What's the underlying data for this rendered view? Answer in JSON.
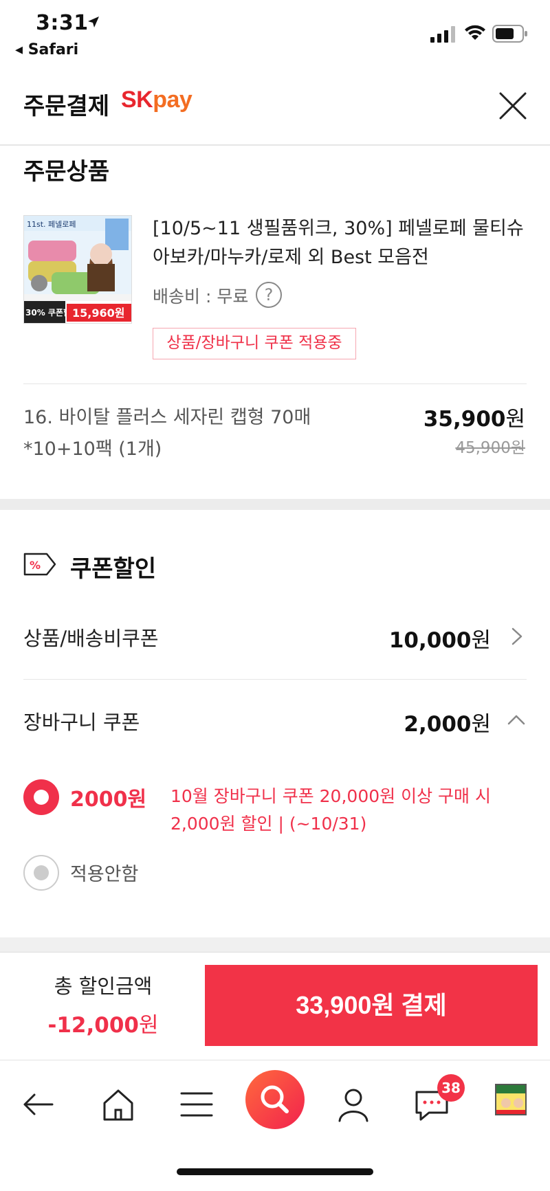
{
  "status_bar": {
    "time": "3:31",
    "back_app": "Safari"
  },
  "header": {
    "title": "주문결제",
    "brand_sk": "SK",
    "brand_pay": "pay"
  },
  "order_section": {
    "title": "주문상품",
    "product_name": "[10/5~11 생필품위크, 30%] 페넬로페 물티슈 아보카/마누카/로제 외 Best 모음전",
    "shipping": "배송비 : 무료",
    "help_symbol": "?",
    "coupon_tag": "상품/장바구니 쿠폰 적용중",
    "thumb_texts": {
      "brand": "11st. 페넬로페",
      "sale": "30% 쿠폰할인",
      "price": "15,960원"
    },
    "option_name": "16. 바이탈 플러스 세자린 캡형 70매*10+10팩 (1개)",
    "price": "35,900",
    "price_unit": "원",
    "original_price": "45,900원"
  },
  "coupon_section": {
    "title": "쿠폰할인",
    "icon_symbol": "%",
    "product_coupon_label": "상품/배송비쿠폰",
    "product_coupon_value": "10,000",
    "cart_coupon_label": "장바구니 쿠폰",
    "cart_coupon_value": "2,000",
    "unit": "원",
    "options": [
      {
        "amount": "2000원",
        "desc": "10월 장바구니 쿠폰 20,000원 이상 구매 시 2,000원 할인 | (~10/31)",
        "selected": true
      },
      {
        "label": "적용안함",
        "selected": false
      }
    ]
  },
  "pay_bar": {
    "total_label": "총 할인금액",
    "total_value": "-12,000",
    "unit": "원",
    "pay_button": "33,900원 결제"
  },
  "nav": {
    "chat_badge": "38"
  },
  "colors": {
    "accent": "#f23347",
    "brand_sk": "#e8262e",
    "brand_pay": "#f36d22"
  }
}
